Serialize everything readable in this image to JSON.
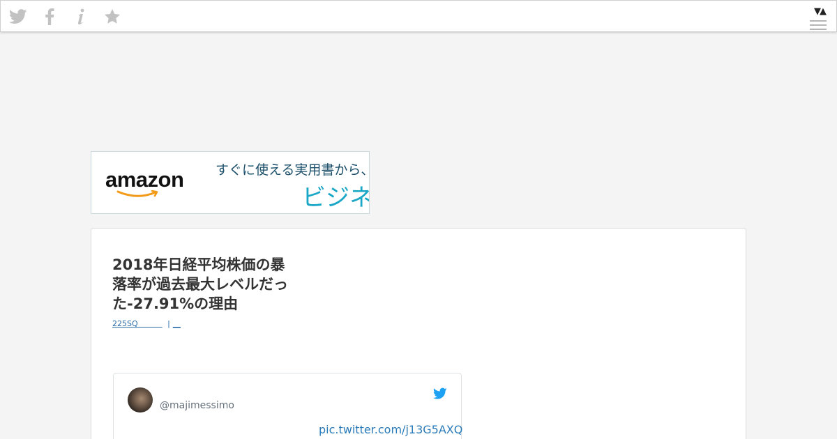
{
  "topbar": {
    "icons": [
      "twitter-icon",
      "facebook-icon",
      "info-icon",
      "star-icon"
    ],
    "arrows": "▼▲",
    "icon_color": "#b9b9b9"
  },
  "ad_banner": {
    "logo_text": "amazon",
    "line1": "すぐに使える実用書から、話",
    "line2": "ビジネス",
    "logo_smile_color": "#f29a18",
    "line2_color": "#1aa7c6"
  },
  "article": {
    "title_lines": [
      "2018年日経平均株価の暴",
      "落率が過去最大レベルだっ",
      "た-27.91%の理由"
    ],
    "meta_category": "225SQ",
    "meta_separator": "|",
    "meta_count": "__"
  },
  "tweet": {
    "handle": "@majimessimo",
    "link": "pic.twitter.com/j13G5AXQ",
    "bird_color": "#1da1f2"
  }
}
